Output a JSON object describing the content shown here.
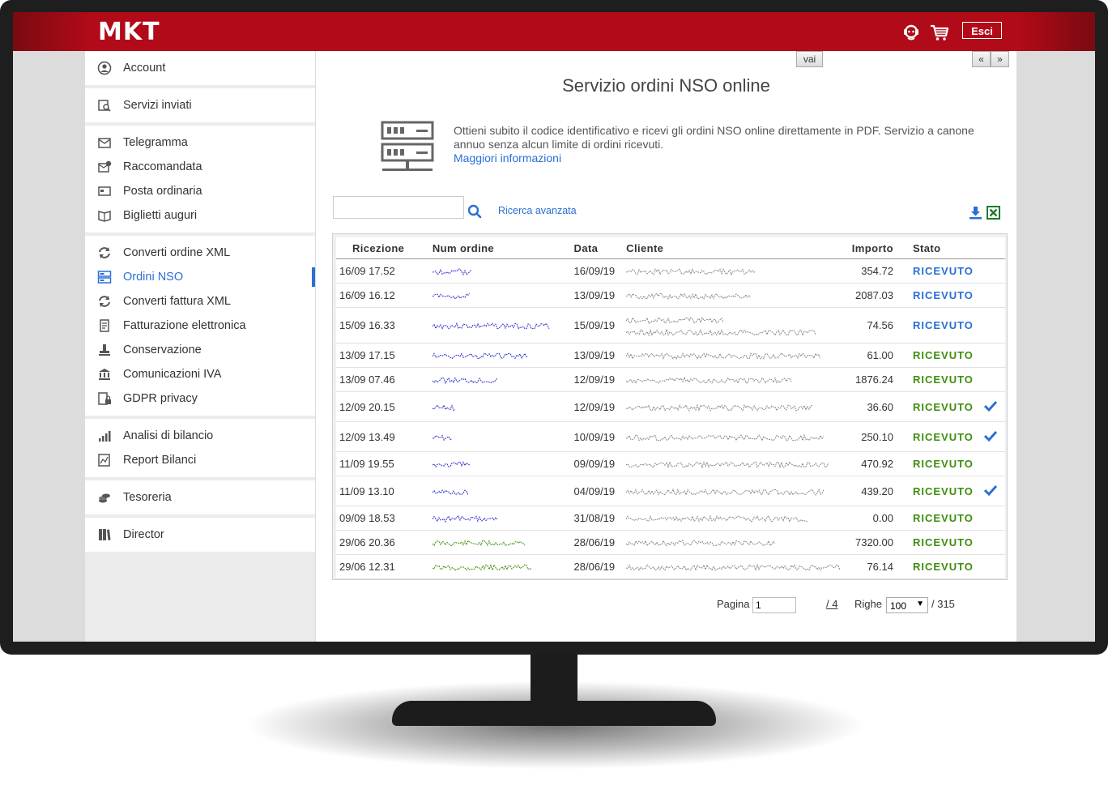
{
  "header": {
    "logo": "MKT",
    "exit_label": "Esci",
    "icons": [
      "support-icon",
      "cart-icon"
    ]
  },
  "sidebar": {
    "groups": [
      [
        {
          "label": "Account",
          "icon": "account-icon"
        }
      ],
      [
        {
          "label": "Servizi inviati",
          "icon": "sent-services-icon"
        }
      ],
      [
        {
          "label": "Telegramma",
          "icon": "telegram-icon"
        },
        {
          "label": "Raccomandata",
          "icon": "registered-mail-icon"
        },
        {
          "label": "Posta ordinaria",
          "icon": "mail-icon"
        },
        {
          "label": "Biglietti auguri",
          "icon": "greeting-card-icon"
        }
      ],
      [
        {
          "label": "Converti ordine XML",
          "icon": "convert-icon"
        },
        {
          "label": "Ordini NSO",
          "icon": "server-icon",
          "active": true
        },
        {
          "label": "Converti fattura XML",
          "icon": "convert-icon"
        },
        {
          "label": "Fatturazione elettronica",
          "icon": "invoice-icon"
        },
        {
          "label": "Conservazione",
          "icon": "archive-icon"
        },
        {
          "label": "Comunicazioni IVA",
          "icon": "bank-icon"
        },
        {
          "label": "GDPR privacy",
          "icon": "privacy-icon"
        }
      ],
      [
        {
          "label": "Analisi di bilancio",
          "icon": "bar-chart-icon"
        },
        {
          "label": "Report Bilanci",
          "icon": "report-icon"
        }
      ],
      [
        {
          "label": "Tesoreria",
          "icon": "coins-icon"
        }
      ],
      [
        {
          "label": "Director",
          "icon": "book-icon"
        }
      ]
    ]
  },
  "main": {
    "title": "Servizio ordini NSO online",
    "promo_text": "Ottieni subito il codice identificativo e ricevi gli ordini NSO online direttamente in PDF. Servizio a canone annuo senza alcun limite di ordini ricevuti.",
    "promo_link": "Maggiori informazioni",
    "search_placeholder": "",
    "advanced_search": "Ricerca avanzata"
  },
  "table": {
    "columns": [
      "Ricezione",
      "Num ordine",
      "Data",
      "Cliente",
      "Importo",
      "Stato"
    ],
    "rows": [
      {
        "ricezione": "16/09 17.52",
        "data": "16/09/19",
        "importo": "354.72",
        "stato": "RICEVUTO",
        "status_color": "#2a6fd6",
        "check": false,
        "order_color": "#2e2ecf"
      },
      {
        "ricezione": "16/09 16.12",
        "data": "13/09/19",
        "importo": "2087.03",
        "stato": "RICEVUTO",
        "status_color": "#2a6fd6",
        "check": false,
        "order_color": "#2e2ecf"
      },
      {
        "ricezione": "15/09 16.33",
        "data": "15/09/19",
        "importo": "74.56",
        "stato": "RICEVUTO",
        "status_color": "#2a6fd6",
        "check": false,
        "order_color": "#2e2ecf",
        "tall": true
      },
      {
        "ricezione": "13/09 17.15",
        "data": "13/09/19",
        "importo": "61.00",
        "stato": "RICEVUTO",
        "status_color": "#3e8e0e",
        "check": false,
        "order_color": "#2e2ecf"
      },
      {
        "ricezione": "13/09 07.46",
        "data": "12/09/19",
        "importo": "1876.24",
        "stato": "RICEVUTO",
        "status_color": "#3e8e0e",
        "check": false,
        "order_color": "#2e2ecf"
      },
      {
        "ricezione": "12/09 20.15",
        "data": "12/09/19",
        "importo": "36.60",
        "stato": "RICEVUTO",
        "status_color": "#3e8e0e",
        "check": true,
        "order_color": "#2e2ecf"
      },
      {
        "ricezione": "12/09 13.49",
        "data": "10/09/19",
        "importo": "250.10",
        "stato": "RICEVUTO",
        "status_color": "#3e8e0e",
        "check": true,
        "order_color": "#2e2ecf"
      },
      {
        "ricezione": "11/09 19.55",
        "data": "09/09/19",
        "importo": "470.92",
        "stato": "RICEVUTO",
        "status_color": "#3e8e0e",
        "check": false,
        "order_color": "#2e2ecf"
      },
      {
        "ricezione": "11/09 13.10",
        "data": "04/09/19",
        "importo": "439.20",
        "stato": "RICEVUTO",
        "status_color": "#3e8e0e",
        "check": true,
        "order_color": "#2e2ecf"
      },
      {
        "ricezione": "09/09 18.53",
        "data": "31/08/19",
        "importo": "0.00",
        "stato": "RICEVUTO",
        "status_color": "#3e8e0e",
        "check": false,
        "order_color": "#2e2ecf"
      },
      {
        "ricezione": "29/06 20.36",
        "data": "28/06/19",
        "importo": "7320.00",
        "stato": "RICEVUTO",
        "status_color": "#3e8e0e",
        "check": false,
        "order_color": "#3e8e0e"
      },
      {
        "ricezione": "29/06 12.31",
        "data": "28/06/19",
        "importo": "76.14",
        "stato": "RICEVUTO",
        "status_color": "#3e8e0e",
        "check": false,
        "order_color": "#3e8e0e"
      }
    ]
  },
  "pagination": {
    "page_label": "Pagina",
    "page_value": "1",
    "go_label": "vai",
    "total_pages": "/ 4",
    "rows_label": "Righe",
    "rows_value": "100",
    "total_rows": "/ 315",
    "prev_label": "«",
    "next_label": "»"
  },
  "colors": {
    "brand_red": "#b10a18",
    "link_blue": "#2a6fd6",
    "status_green": "#3e8e0e"
  }
}
